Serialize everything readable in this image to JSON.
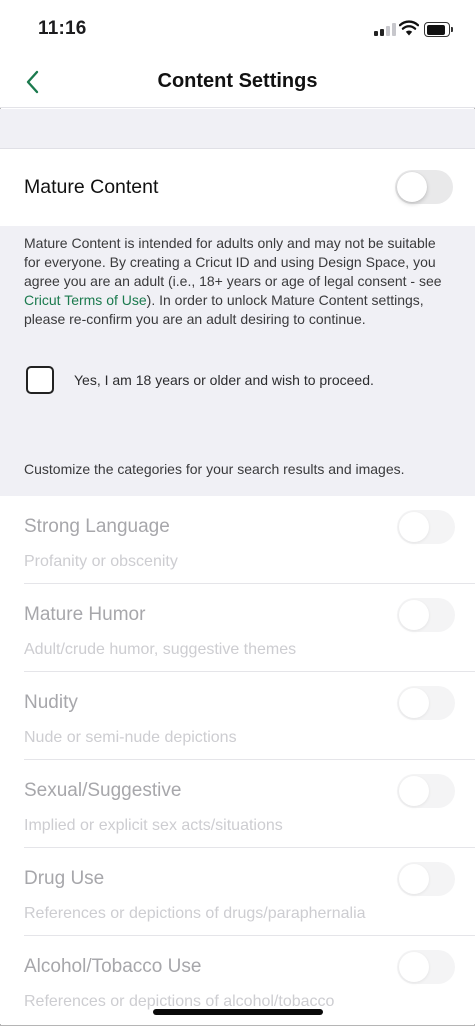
{
  "status_bar": {
    "time": "11:16",
    "signal_icon": "cellular-signal-icon",
    "wifi_icon": "wifi-icon",
    "battery_icon": "battery-icon"
  },
  "nav": {
    "back_icon": "chevron-left-icon",
    "title": "Content Settings"
  },
  "colors": {
    "accent": "#1b7a4e",
    "background_gray": "#f0f0f5",
    "disabled_text": "#a7a7ab"
  },
  "mature": {
    "label": "Mature Content",
    "toggle_on": false,
    "description_part1": "Mature Content is intended for adults only and may not be suitable for everyone. By creating a Cricut ID and using Design Space, you agree you are an adult (i.e., 18+ years or age of legal consent - see ",
    "terms_link": "Cricut Terms of Use",
    "description_part2": "). In order to unlock Mature Content settings, please re-confirm you are an adult desiring to continue.",
    "confirm_label": "Yes, I am 18 years or older and wish to proceed.",
    "confirm_checked": false
  },
  "customize_text": "Customize the categories for your search results and images.",
  "categories": [
    {
      "title": "Strong Language",
      "subtitle": "Profanity or obscenity",
      "enabled": false
    },
    {
      "title": "Mature Humor",
      "subtitle": "Adult/crude humor, suggestive themes",
      "enabled": false
    },
    {
      "title": "Nudity",
      "subtitle": "Nude or semi-nude depictions",
      "enabled": false
    },
    {
      "title": "Sexual/Suggestive",
      "subtitle": "Implied or explicit sex acts/situations",
      "enabled": false
    },
    {
      "title": "Drug Use",
      "subtitle": "References or depictions of drugs/paraphernalia",
      "enabled": false
    },
    {
      "title": "Alcohol/Tobacco Use",
      "subtitle": "References or depictions of alcohol/tobacco",
      "enabled": false
    }
  ]
}
